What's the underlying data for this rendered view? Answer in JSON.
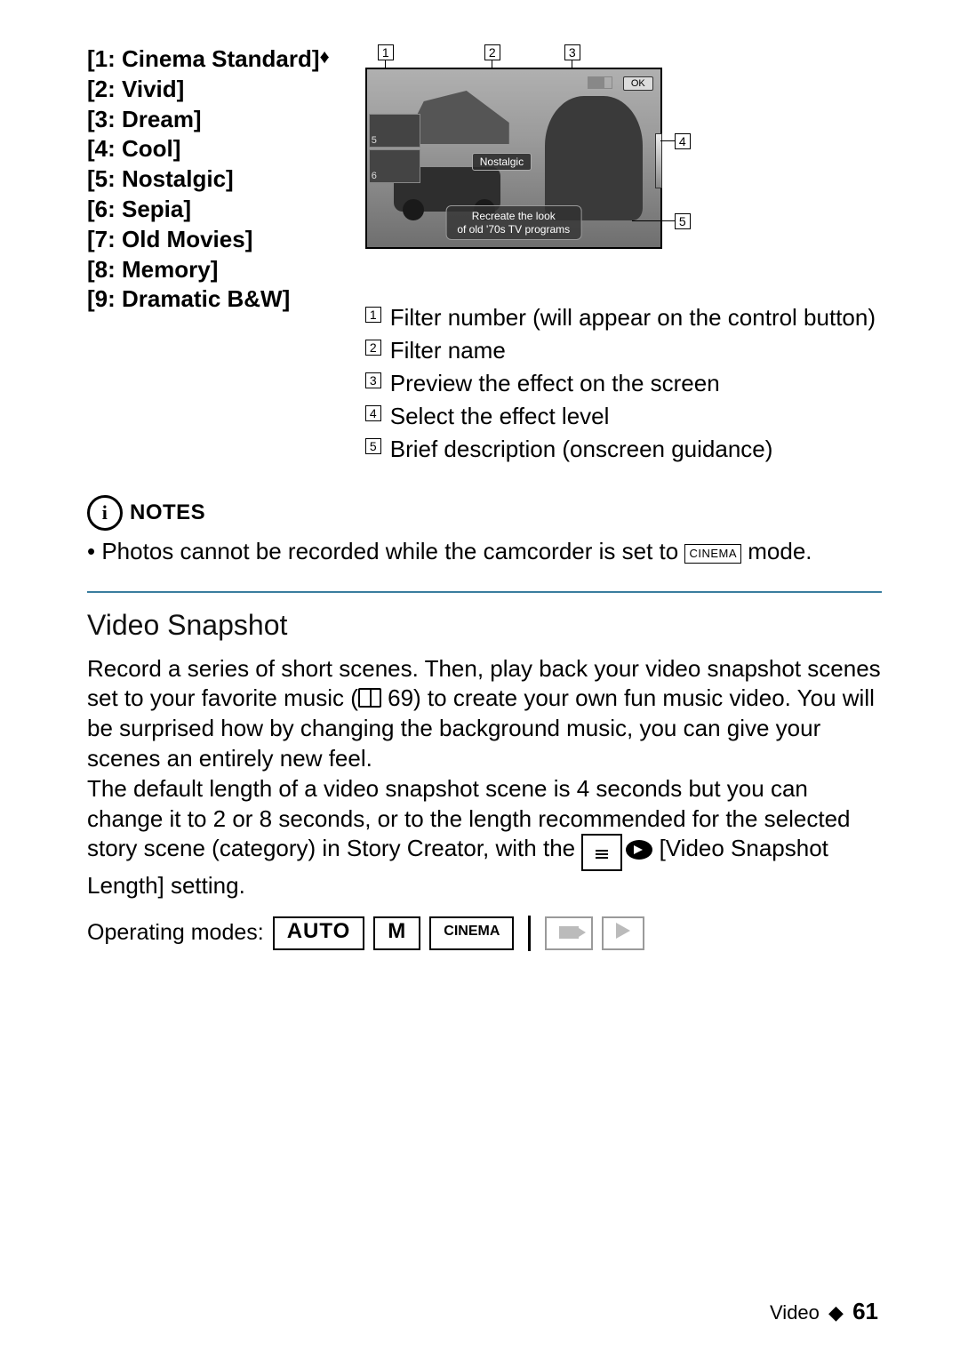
{
  "filters": [
    "[1: Cinema Standard]",
    "[2: Vivid]",
    "[3: Dream]",
    "[4: Cool]",
    "[5: Nostalgic]",
    "[6: Sepia]",
    "[7: Old Movies]",
    "[8: Memory]",
    "[9: Dramatic B&W]"
  ],
  "default_marker": "♦",
  "preview": {
    "ok_label": "OK",
    "name_label": "Nostalgic",
    "desc_line1": "Recreate the look",
    "desc_line2": "of old '70s TV programs",
    "thumb5": "5",
    "thumb6": "6"
  },
  "callouts": {
    "c1": "1",
    "c2": "2",
    "c3": "3",
    "c4": "4",
    "c5": "5"
  },
  "legend": {
    "l1": "Filter number (will appear on the control button)",
    "l2": "Filter name",
    "l3": "Preview the effect on the screen",
    "l4": "Select the effect level",
    "l5": "Brief description (onscreen guidance)"
  },
  "notes": {
    "heading": "NOTES",
    "bullet_pre": "Photos cannot be recorded while the camcorder is set to ",
    "cinema_chip": "CINEMA",
    "bullet_post": " mode."
  },
  "section": {
    "title": "Video Snapshot",
    "p1a": "Record a series of short scenes. Then, play back your video snapshot scenes set to your favorite music (",
    "p1_ref": " 69",
    "p1b": ") to create your own fun music video. You will be surprised how by changing the background music, you can give your scenes an entirely new feel.",
    "p2a": "The default length of a video snapshot scene is 4 seconds but you can change it to 2 or 8 seconds, or to the length recommended for the selected story scene (category) in Story Creator, with the ",
    "p2b": " [Video Snapshot Length] setting."
  },
  "modes_label": "Operating modes:",
  "modes": {
    "auto": "AUTO",
    "m": "M",
    "cinema": "CINEMA"
  },
  "footer": {
    "section": "Video",
    "sep": "◆",
    "page": "61"
  }
}
